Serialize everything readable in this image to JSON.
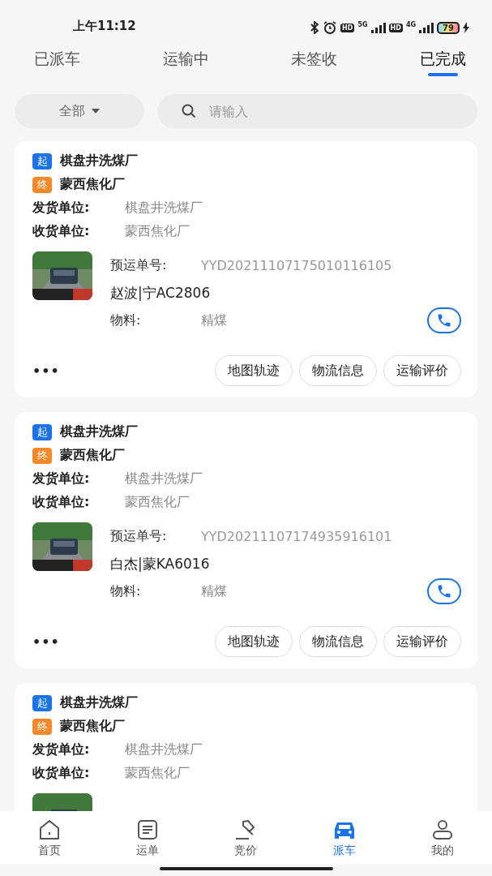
{
  "status_bar": {
    "time": "上午11:12",
    "hd_1": "HD",
    "network_1": "5G",
    "hd_2": "HD",
    "network_2": "4G",
    "battery": "79"
  },
  "tabs": [
    {
      "label": "已派车",
      "selected": false
    },
    {
      "label": "运输中",
      "selected": false
    },
    {
      "label": "未签收",
      "selected": false
    },
    {
      "label": "已完成",
      "selected": true
    }
  ],
  "filter": {
    "label": "全部"
  },
  "search": {
    "placeholder": "请输入"
  },
  "cards": [
    {
      "from_tag": "起",
      "from": "棋盘井洗煤厂",
      "to_tag": "终",
      "to": "蒙西焦化厂",
      "shipper_label": "发货单位:",
      "shipper": "棋盘井洗煤厂",
      "receiver_label": "收货单位:",
      "receiver": "蒙西焦化厂",
      "vehicle": {
        "kind": "picture",
        "waybill_label": "预运单号:",
        "waybill": "YYD20211107175010116105",
        "driver": "赵波|宁AC2806",
        "material_label": "物料:",
        "material": "精煤"
      },
      "more": "•••",
      "actions": [
        "地图轨迹",
        "物流信息",
        "运输评价"
      ]
    },
    {
      "from_tag": "起",
      "from": "棋盘井洗煤厂",
      "to_tag": "终",
      "to": "蒙西焦化厂",
      "shipper_label": "发货单位:",
      "shipper": "棋盘井洗煤厂",
      "receiver_label": "收货单位:",
      "receiver": "蒙西焦化厂",
      "vehicle": {
        "kind": "picture",
        "waybill_label": "预运单号:",
        "waybill": "YYD20211107174935916101",
        "driver": "白杰|蒙KA6016",
        "material_label": "物料:",
        "material": "精煤"
      },
      "more": "•••",
      "actions": [
        "地图轨迹",
        "物流信息",
        "运输评价"
      ]
    },
    {
      "from_tag": "起",
      "from": "棋盘井洗煤厂",
      "to_tag": "终",
      "to": "蒙西焦化厂",
      "shipper_label": "发货单位:",
      "shipper": "棋盘井洗煤厂",
      "receiver_label": "收货单位:",
      "receiver": "蒙西焦化厂"
    }
  ],
  "nav": [
    {
      "label": "首页",
      "kind": "home",
      "selected": false
    },
    {
      "label": "运单",
      "kind": "list",
      "selected": false
    },
    {
      "label": "竞价",
      "kind": "gavel",
      "selected": false
    },
    {
      "label": "派车",
      "kind": "car",
      "selected": true
    },
    {
      "label": "我的",
      "kind": "user",
      "selected": false
    }
  ]
}
